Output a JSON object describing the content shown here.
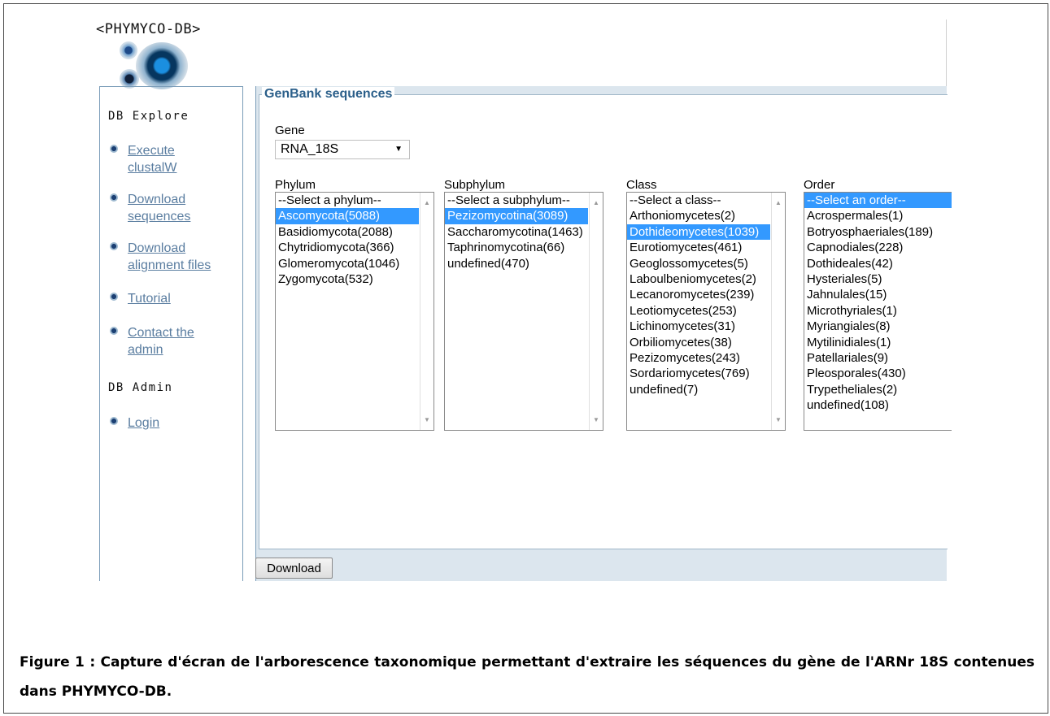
{
  "logo": {
    "text": "<PHYMYCO-DB>"
  },
  "sidebar": {
    "explore_heading": "DB Explore",
    "explore_items": [
      {
        "label_lines": [
          "Execute",
          "clustalW"
        ]
      },
      {
        "label_lines": [
          "Download",
          "sequences"
        ]
      },
      {
        "label_lines": [
          "Download",
          "alignment files"
        ]
      },
      {
        "label_lines": [
          "Tutorial"
        ]
      },
      {
        "label_lines": [
          "Contact the",
          "admin"
        ]
      }
    ],
    "admin_heading": "DB Admin",
    "admin_items": [
      {
        "label_lines": [
          "Login"
        ]
      }
    ]
  },
  "main": {
    "legend": "GenBank sequences",
    "gene": {
      "label": "Gene",
      "value": "RNA_18S"
    },
    "lists": [
      {
        "label": "Phylum",
        "options": [
          "--Select a phylum--",
          "Ascomycota(5088)",
          "Basidiomycota(2088)",
          "Chytridiomycota(366)",
          "Glomeromycota(1046)",
          "Zygomycota(532)"
        ],
        "selected": 1
      },
      {
        "label": "Subphylum",
        "options": [
          "--Select a subphylum--",
          "Pezizomycotina(3089)",
          "Saccharomycotina(1463)",
          "Taphrinomycotina(66)",
          "undefined(470)"
        ],
        "selected": 1
      },
      {
        "label": "Class",
        "options": [
          "--Select a class--",
          "Arthoniomycetes(2)",
          "Dothideomycetes(1039)",
          "Eurotiomycetes(461)",
          "Geoglossomycetes(5)",
          "Laboulbeniomycetes(2)",
          "Lecanoromycetes(239)",
          "Leotiomycetes(253)",
          "Lichinomycetes(31)",
          "Orbiliomycetes(38)",
          "Pezizomycetes(243)",
          "Sordariomycetes(769)",
          "undefined(7)"
        ],
        "selected": 2
      },
      {
        "label": "Order",
        "options": [
          "--Select an order--",
          "Acrospermales(1)",
          "Botryosphaeriales(189)",
          "Capnodiales(228)",
          "Dothideales(42)",
          "Hysteriales(5)",
          "Jahnulales(15)",
          "Microthyriales(1)",
          "Myriangiales(8)",
          "Mytilinidiales(1)",
          "Patellariales(9)",
          "Pleosporales(430)",
          "Trypetheliales(2)",
          "undefined(108)"
        ],
        "selected": 0
      }
    ],
    "download_label": "Download"
  },
  "caption": "Figure 1 : Capture d'écran de l'arborescence taxonomique permettant d'extraire les séquences du gène de l'ARNr 18S contenues dans PHYMYCO-DB.",
  "colors": {
    "selection": "#3399ff",
    "link": "#5a7da0",
    "legend": "#2b5f8a",
    "panel_bg": "#dce6ee"
  }
}
